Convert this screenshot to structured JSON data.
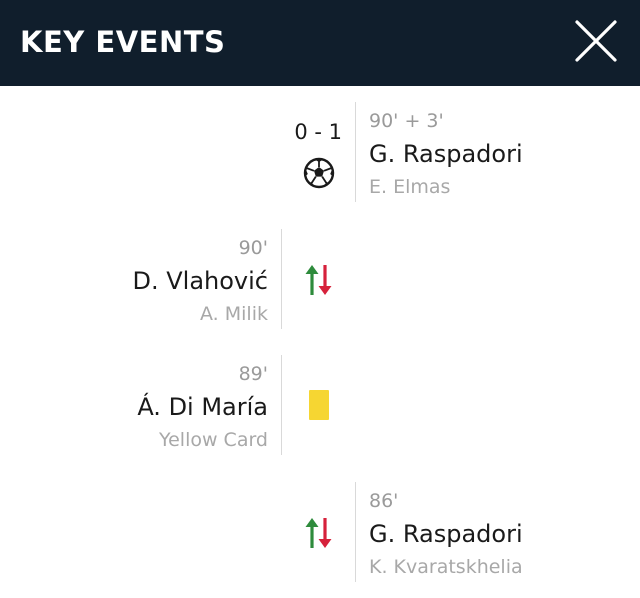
{
  "header": {
    "title": "KEY EVENTS",
    "close_icon": "close-icon"
  },
  "events": [
    {
      "side": "right",
      "minute": "90' + 3'",
      "player": "G. Raspadori",
      "detail": "E. Elmas",
      "score": "0 - 1",
      "icon": "football-icon"
    },
    {
      "side": "left",
      "minute": "90'",
      "player": "D. Vlahović",
      "detail": "A. Milik",
      "icon": "substitution-icon"
    },
    {
      "side": "left",
      "minute": "89'",
      "player": "Á. Di María",
      "detail": "Yellow Card",
      "icon": "yellow-card-icon",
      "card_color": "#f6d632"
    },
    {
      "side": "right",
      "minute": "86'",
      "player": "G. Raspadori",
      "detail": "K. Kvaratskhelia",
      "icon": "substitution-icon"
    }
  ],
  "colors": {
    "header_bg": "#101e2c",
    "sub_in": "#2e8b3c",
    "sub_out": "#d6213b",
    "divider": "#d9d9d9"
  }
}
